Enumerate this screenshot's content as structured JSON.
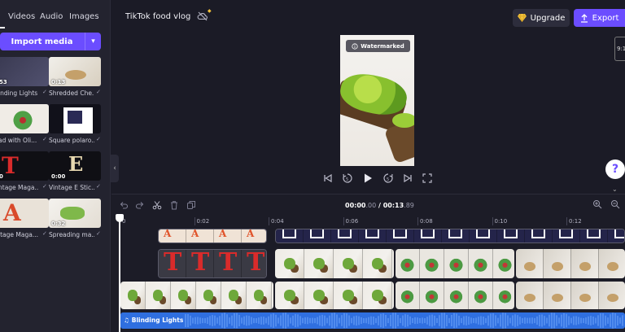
{
  "project": {
    "title": "TikTok food vlog"
  },
  "tabs": [
    {
      "label": "Videos"
    },
    {
      "label": "Audio"
    },
    {
      "label": "Images"
    }
  ],
  "import_button": {
    "label": "Import media",
    "chevron": "▾"
  },
  "media": [
    {
      "label": "Blinding Lights",
      "visible_label": "inding Lights",
      "duration": "53",
      "thumb": "t-blind"
    },
    {
      "label": "Shredded Che...",
      "visible_label": "Shredded Che...",
      "duration": "0:13",
      "thumb": "t-shred"
    },
    {
      "label": "Salad with Oli...",
      "visible_label": "ad with Oli...",
      "duration": "",
      "thumb": "t-salad"
    },
    {
      "label": "Square polaro...",
      "visible_label": "Square polaro...",
      "duration": "",
      "thumb": "t-polar"
    },
    {
      "label": "Vintage Maga...",
      "visible_label": "ntage Maga...",
      "duration": "0",
      "thumb": "t-maga"
    },
    {
      "label": "Vintage E Stic...",
      "visible_label": "Vintage E Stic...",
      "duration": "0:00",
      "thumb": "t-sticE"
    },
    {
      "label": "Vintage Maga...",
      "visible_label": "itage Maga...",
      "duration": "",
      "thumb": "t-magaA"
    },
    {
      "label": "Spreading ma...",
      "visible_label": "Spreading ma...",
      "duration": "0:32",
      "thumb": "t-spread"
    }
  ],
  "topbar": {
    "upgrade_label": "Upgrade",
    "export_label": "Export"
  },
  "preview": {
    "watermark": "Watermarked",
    "aspect_ratio": "9:16"
  },
  "help": {
    "label": "?"
  },
  "timeline": {
    "current_time": "00:00",
    "current_ms": ".00",
    "separator": " / ",
    "total_time": "00:13",
    "total_ms": ".89",
    "ruler": [
      "0",
      "0:02",
      "0:04",
      "0:06",
      "0:08",
      "0:10",
      "0:12"
    ],
    "audio_track": "Blinding Lights"
  },
  "colors": {
    "accent": "#6b4dff",
    "audio_track": "#2f6fe0",
    "background": "#1b1b26",
    "panel": "#23232f",
    "gem": "#f3c23a"
  }
}
